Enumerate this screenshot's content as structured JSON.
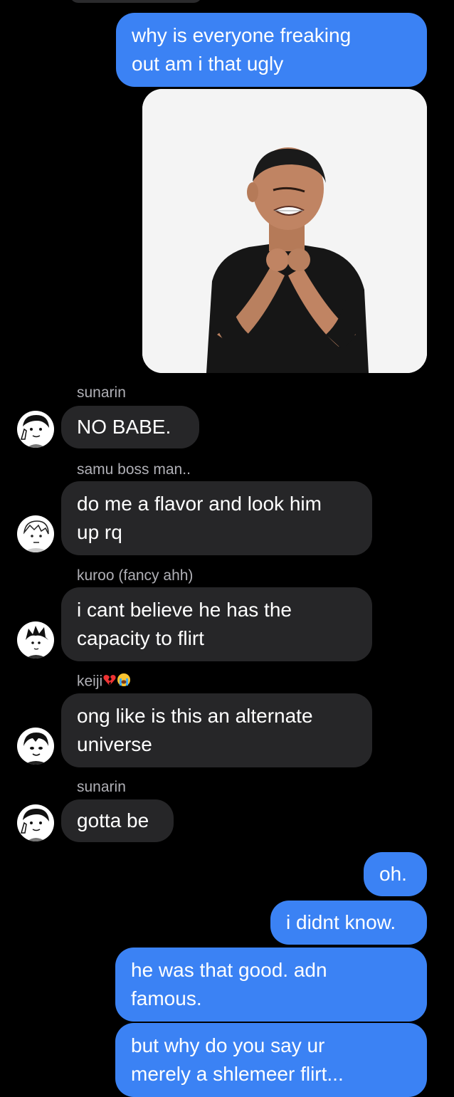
{
  "messages": [
    {
      "type": "sent",
      "text": "why is everyone freaking\nout am i that ugly"
    },
    {
      "type": "sent-image",
      "icon": "photo-man-choking-himself"
    },
    {
      "type": "received",
      "sender": "sunarin",
      "avatar": "anime-boy-peace-sign-avatar",
      "text": "NO BABE."
    },
    {
      "type": "received",
      "sender": "samu boss man..",
      "avatar": "anime-boy-light-hair-avatar",
      "text": "do me a flavor and look him\nup rq"
    },
    {
      "type": "received",
      "sender": "kuroo (fancy ahh)",
      "avatar": "anime-boy-spiky-hair-avatar",
      "text": "i cant believe he has the\ncapacity to flirt"
    },
    {
      "type": "received",
      "sender": "keiji",
      "sender_emojis": [
        "broken-heart-emoji",
        "loudly-crying-face-emoji"
      ],
      "avatar": "anime-boy-dark-hair-avatar",
      "text": "ong like is this an alternate\nuniverse"
    },
    {
      "type": "received",
      "sender": "sunarin",
      "avatar": "anime-boy-peace-sign-avatar",
      "text": "gotta be"
    },
    {
      "type": "sent",
      "text": "oh."
    },
    {
      "type": "sent",
      "text": "i didnt know."
    },
    {
      "type": "sent",
      "text": "he was that good. adn\nfamous."
    },
    {
      "type": "sent",
      "text": "but why do you say ur\nmerely a shlemeer flirt..."
    }
  ],
  "colors": {
    "background": "#000000",
    "sent_bubble": "#3b82f4",
    "received_bubble": "#262628",
    "sender_name": "#b0b0b6"
  }
}
